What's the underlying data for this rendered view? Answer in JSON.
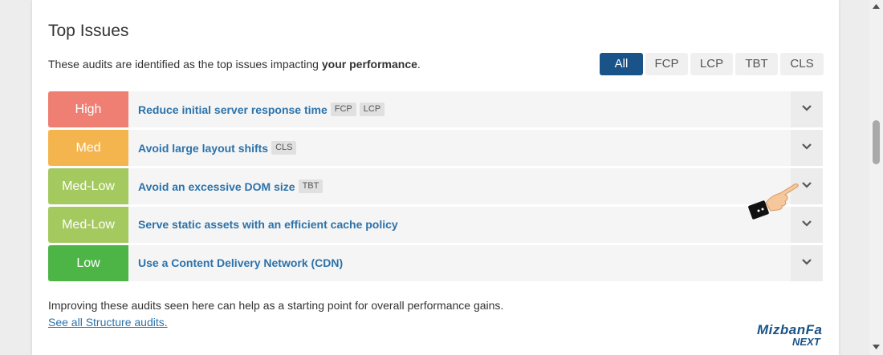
{
  "section": {
    "title": "Top Issues",
    "description_prefix": "These audits are identified as the top issues impacting ",
    "description_bold": "your performance",
    "description_suffix": "."
  },
  "filters": [
    {
      "label": "All",
      "active": true
    },
    {
      "label": "FCP",
      "active": false
    },
    {
      "label": "LCP",
      "active": false
    },
    {
      "label": "TBT",
      "active": false
    },
    {
      "label": "CLS",
      "active": false
    }
  ],
  "issues": [
    {
      "severity": "High",
      "color": "#ef7e73",
      "title": "Reduce initial server response time",
      "tags": [
        "FCP",
        "LCP"
      ]
    },
    {
      "severity": "Med",
      "color": "#f5b54e",
      "title": "Avoid large layout shifts",
      "tags": [
        "CLS"
      ]
    },
    {
      "severity": "Med-Low",
      "color": "#a4c95f",
      "title": "Avoid an excessive DOM size",
      "tags": [
        "TBT"
      ]
    },
    {
      "severity": "Med-Low",
      "color": "#a4c95f",
      "title": "Serve static assets with an efficient cache policy",
      "tags": []
    },
    {
      "severity": "Low",
      "color": "#4db546",
      "title": "Use a Content Delivery Network (CDN)",
      "tags": []
    }
  ],
  "footer": {
    "text": "Improving these audits seen here can help as a starting point for overall performance gains.",
    "link": "See all Structure audits."
  },
  "watermark": {
    "main": "MizbanFa",
    "sub": "NEXT"
  }
}
